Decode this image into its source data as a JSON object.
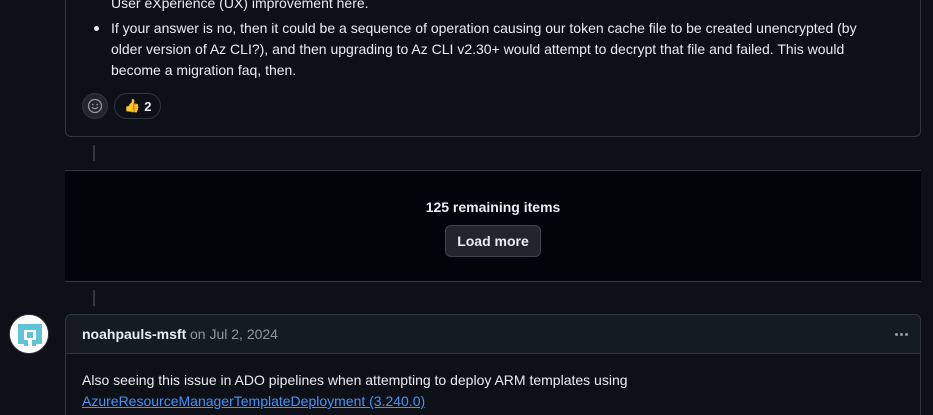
{
  "top_comment": {
    "partial_line": "User eXperience (UX) improvement here.",
    "bullet_lines": [
      "If your answer is no, then it could be a sequence of operation causing our token cache file to be created unencrypted (by",
      "older version of Az CLI?), and then upgrading to Az CLI v2.30+ would attempt to decrypt that file and failed. This would",
      "become a migration faq, then."
    ],
    "reactions": {
      "add_reaction_icon": "smiley-icon",
      "thumbs_up_emoji": "👍",
      "thumbs_up_count": "2"
    }
  },
  "hidden_items": {
    "remaining_text": "125 remaining items",
    "load_more_label": "Load more"
  },
  "comment": {
    "author": "noahpauls-msft",
    "date": "on Jul 2, 2024",
    "body_text": "Also seeing this issue in ADO pipelines when attempting to deploy ARM templates using",
    "link_text": "AzureResourceManagerTemplateDeployment (3.240.0)"
  },
  "colors": {
    "background": "#0d1117",
    "border": "#30363d",
    "link": "#4493f8",
    "muted": "#9198a1"
  }
}
